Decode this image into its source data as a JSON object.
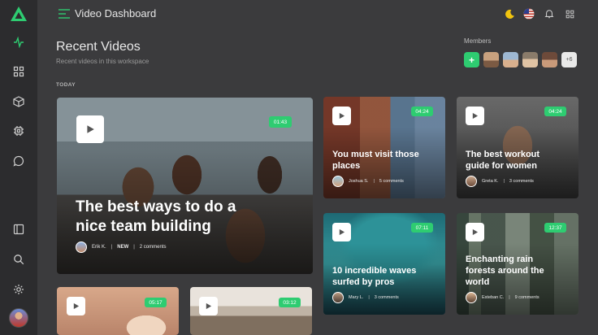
{
  "app": {
    "title": "Video Dashboard"
  },
  "header": {
    "title": "Recent Videos",
    "subtitle": "Recent videos in this workspace",
    "group_label": "TODAY"
  },
  "members": {
    "label": "Members",
    "add": "+",
    "more": "+6"
  },
  "colors": {
    "accent": "#2ecc71",
    "background": "#3b3b3d",
    "sidebar": "#2c2c2e"
  },
  "videos": [
    {
      "title_line1": "The best ways to do a",
      "title_line2": "nice team building",
      "duration": "01:43",
      "author": "Erik K.",
      "tag": "NEW",
      "comments": "2 comments"
    },
    {
      "title_line1": "You must visit those",
      "title_line2": "places",
      "duration": "04:24",
      "author": "Joshua S.",
      "comments": "5 comments"
    },
    {
      "title_line1": "The best workout",
      "title_line2": "guide for women",
      "duration": "04:24",
      "author": "Greta K.",
      "comments": "3 comments"
    },
    {
      "title_line1": "10 incredible waves",
      "title_line2": "surfed by pros",
      "duration": "07:11",
      "author": "Mary L.",
      "comments": "3 comments"
    },
    {
      "title_line1": "Enchanting rain",
      "title_line2": "forests around the",
      "title_line3": "world",
      "duration": "12:37",
      "author": "Esteban C.",
      "comments": "9 comments"
    },
    {
      "duration": "05:17"
    },
    {
      "duration": "03:12"
    }
  ]
}
